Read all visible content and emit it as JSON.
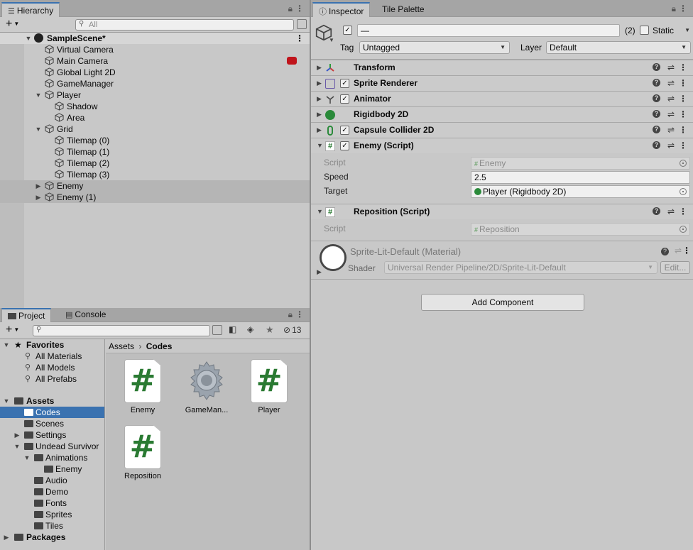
{
  "hierarchy": {
    "tab": "Hierarchy",
    "search_placeholder": "All",
    "scene": "SampleScene*",
    "items": [
      {
        "label": "Virtual Camera"
      },
      {
        "label": "Main Camera"
      },
      {
        "label": "Global Light 2D"
      },
      {
        "label": "GameManager"
      },
      {
        "label": "Player"
      },
      {
        "label": "Shadow"
      },
      {
        "label": "Area"
      },
      {
        "label": "Grid"
      },
      {
        "label": "Tilemap (0)"
      },
      {
        "label": "Tilemap (1)"
      },
      {
        "label": "Tilemap (2)"
      },
      {
        "label": "Tilemap (3)"
      },
      {
        "label": "Enemy"
      },
      {
        "label": "Enemy (1)"
      }
    ]
  },
  "inspector": {
    "tabs": [
      "Inspector",
      "Tile Palette"
    ],
    "object_name": "—",
    "count": "(2)",
    "static_label": "Static",
    "tag_label": "Tag",
    "tag_value": "Untagged",
    "layer_label": "Layer",
    "layer_value": "Default",
    "components": [
      "Transform",
      "Sprite Renderer",
      "Animator",
      "Rigidbody 2D",
      "Capsule Collider 2D",
      "Enemy (Script)",
      "Reposition (Script)"
    ],
    "enemy_props": {
      "script_label": "Script",
      "script_value": "Enemy",
      "speed_label": "Speed",
      "speed_value": "2.5",
      "target_label": "Target",
      "target_value": "Player (Rigidbody 2D)"
    },
    "reposition_props": {
      "script_label": "Script",
      "script_value": "Reposition"
    },
    "material": {
      "name": "Sprite-Lit-Default (Material)",
      "shader_label": "Shader",
      "shader_value": "Universal Render Pipeline/2D/Sprite-Lit-Default",
      "edit_label": "Edit..."
    },
    "add_component": "Add Component"
  },
  "project": {
    "tabs": [
      "Project",
      "Console"
    ],
    "hidden_count": "13",
    "favorites": {
      "label": "Favorites",
      "items": [
        "All Materials",
        "All Models",
        "All Prefabs"
      ]
    },
    "assets_label": "Assets",
    "tree": [
      "Codes",
      "Scenes",
      "Settings",
      "Undead Survivor",
      "Animations",
      "Enemy",
      "Audio",
      "Demo",
      "Fonts",
      "Sprites",
      "Tiles"
    ],
    "packages_label": "Packages",
    "breadcrumb": [
      "Assets",
      "Codes"
    ],
    "files": [
      {
        "name": "Enemy",
        "kind": "script"
      },
      {
        "name": "GameMan...",
        "kind": "gear"
      },
      {
        "name": "Player",
        "kind": "script"
      },
      {
        "name": "Reposition",
        "kind": "script"
      }
    ]
  }
}
